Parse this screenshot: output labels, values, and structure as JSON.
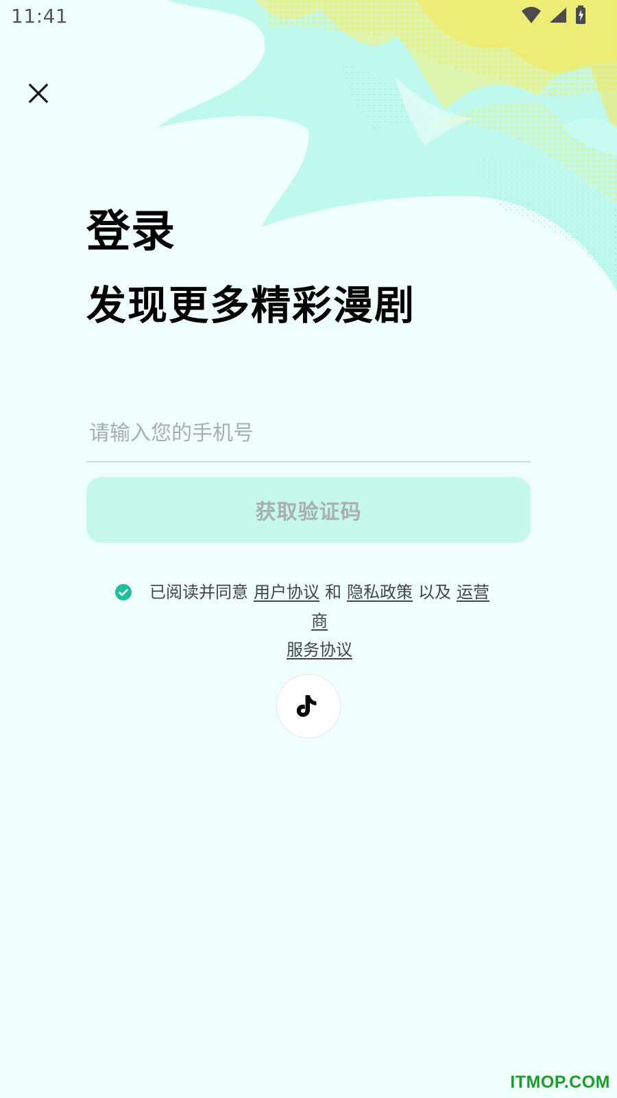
{
  "status_bar": {
    "time": "11:41",
    "icons": [
      "wifi-icon",
      "cellular-signal-icon",
      "battery-charging-icon"
    ]
  },
  "navigation": {
    "close_icon": "close-icon"
  },
  "heading": {
    "title": "登录",
    "subtitle": "发现更多精彩漫剧"
  },
  "phone": {
    "value": "",
    "placeholder": "请输入您的手机号"
  },
  "actions": {
    "get_code_label": "获取验证码"
  },
  "agreement": {
    "checked": true,
    "prefix": "已阅读并同意",
    "user_agreement": "用户协议",
    "and": "和",
    "privacy_policy": "隐私政策",
    "and_also": "以及",
    "operator_agreement_line1": "运营商",
    "operator_agreement_line2": "服务协议"
  },
  "third_party_login": {
    "icon": "douyin-icon"
  },
  "watermark": {
    "text": "ITMOP.COM"
  },
  "colors": {
    "background": "#effffb",
    "accent": "#c5f7ea",
    "checked": "#1fbf9b",
    "watermark": "#1f9b2d",
    "art_mint": "#bff8ed",
    "art_yellow": "#f6f26a"
  }
}
